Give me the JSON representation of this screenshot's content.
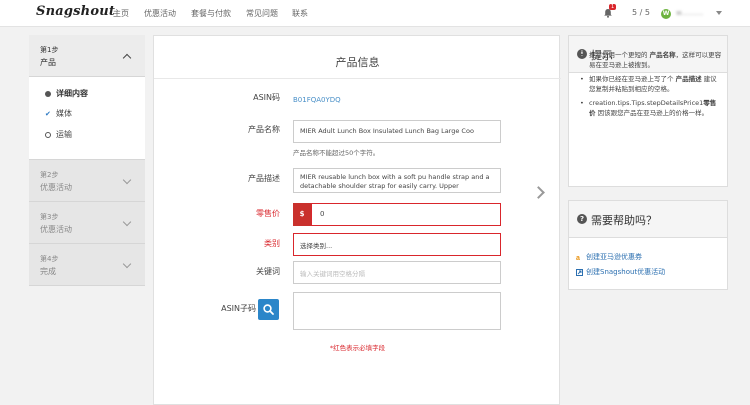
{
  "header": {
    "logo": "Snagshout",
    "nav": [
      "主页",
      "优惠活动",
      "套餐与付款",
      "常见问题",
      "联系"
    ],
    "notification_count": "1",
    "page_counter": "5 / 5",
    "avatar_letter": "W",
    "username": "w.........."
  },
  "steps": {
    "step1": {
      "num": "第1步",
      "name": "产品"
    },
    "substeps": [
      {
        "label": "详细内容",
        "state": "current"
      },
      {
        "label": "媒体",
        "state": "done"
      },
      {
        "label": "运输",
        "state": "todo"
      }
    ],
    "step2": {
      "num": "第2步",
      "name": "优惠活动"
    },
    "step3": {
      "num": "第3步",
      "name": "优惠活动"
    },
    "step4": {
      "num": "第4步",
      "name": "完成"
    }
  },
  "form": {
    "title": "产品信息",
    "asin_label": "ASIN码",
    "asin_value": "B01FQA0YDQ",
    "name_label": "产品名称",
    "name_value": "MIER Adult Lunch Box Insulated Lunch Bag Large Coo",
    "name_hint": "产品名称不能超过50个字符。",
    "desc_label": "产品描述",
    "desc_value": "MIER reusable lunch box with a soft pu handle strap and a detachable shoulder strap for easily carry. Upper",
    "price_label": "零售价",
    "price_prefix": "$",
    "price_value": "0",
    "category_label": "类别",
    "category_value": "选择类别...",
    "keywords_label": "关键词",
    "keywords_placeholder": "输入关键词用空格分隔",
    "asin_child_label": "ASIN子码",
    "required_note": "*红色表示必填字段"
  },
  "tips_panel": {
    "title": "提示",
    "items": [
      {
        "pre": "推荐您用一个更短的 ",
        "bold": "产品名称",
        "post": "，这样可以更容易在亚马逊上被搜到。"
      },
      {
        "pre": "如果你已经在亚马逊上写了个 ",
        "bold": "产品描述",
        "post": " 建议您复制并粘贴到相应的空格。"
      },
      {
        "pre": "creation.tips.Tips.stepDetailsPrice1",
        "bold": "零售价",
        "post": " 因该跟您产品在亚马逊上的价格一样。"
      }
    ]
  },
  "help_panel": {
    "title": "需要帮助吗？",
    "links": [
      "创建亚马逊优惠券",
      "创建Snagshout优惠活动"
    ]
  },
  "colors": {
    "accent": "#2b86c9",
    "required": "#d9262c",
    "avatar": "#6cb33e"
  }
}
